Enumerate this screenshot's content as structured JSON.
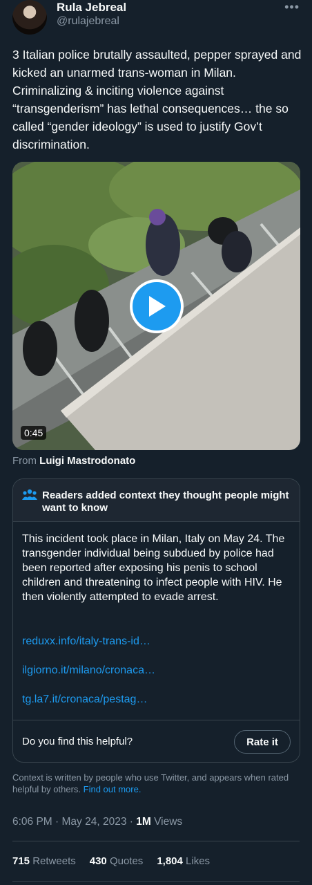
{
  "author": {
    "name": "Rula Jebreal",
    "handle": "@rulajebreal"
  },
  "more_icon": "more-horizontal-icon",
  "tweet_text": "3 Italian police brutally assaulted, pepper sprayed and kicked an unarmed trans-woman in Milan. Criminalizing & inciting violence against “transgenderism” has lethal consequences… the so called “gender ideology” is used to justify Gov’t discrimination.",
  "video": {
    "duration": "0:45",
    "from_label": "From",
    "from_name": "Luigi Mastrodonato"
  },
  "community_note": {
    "title": "Readers added context they thought people might want to know",
    "body": "This incident took place in Milan, Italy on May 24. The transgender individual being subdued by police had been reported after exposing his penis to school children and threatening to infect people with HIV. He then violently attempted to evade arrest.",
    "links": [
      "reduxx.info/italy-trans-id…",
      "ilgiorno.it/milano/cronaca…",
      "tg.la7.it/cronaca/pestag…"
    ],
    "helpful_question": "Do you find this helpful?",
    "rate_label": "Rate it"
  },
  "disclaimer": {
    "text": "Context is written by people who use Twitter, and appears when rated helpful by others.",
    "link": "Find out more."
  },
  "meta": {
    "time": "6:06 PM",
    "date": "May 24, 2023",
    "views_count": "1M",
    "views_label": "Views"
  },
  "stats": {
    "retweets_count": "715",
    "retweets_label": "Retweets",
    "quotes_count": "430",
    "quotes_label": "Quotes",
    "likes_count": "1,804",
    "likes_label": "Likes"
  },
  "colors": {
    "background": "#15202b",
    "accent": "#1d9bf0",
    "secondary_text": "#8b98a5",
    "border": "#38444d"
  }
}
